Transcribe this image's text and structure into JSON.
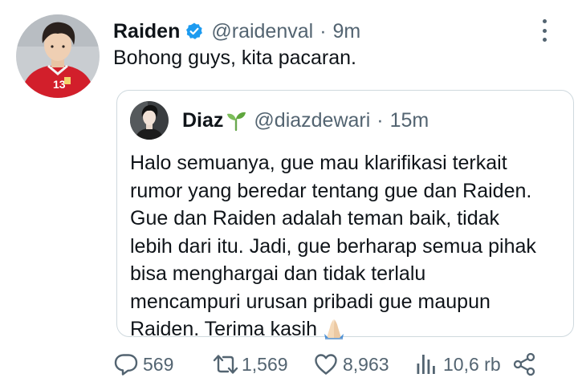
{
  "tweet": {
    "author_name": "Raiden",
    "author_handle": "@raidenval",
    "separator": "·",
    "time": "9m",
    "text": "Bohong guys, kita pacaran.",
    "avatar_icon": "user-avatar-photo",
    "verified_icon": "verified-badge-icon",
    "more_icon": "more-options-icon"
  },
  "quote": {
    "author_name": "Diaz",
    "name_emoji_icon": "seedling-emoji-icon",
    "author_handle": "@diazdewari",
    "separator": "·",
    "time": "15m",
    "lines": [
      "Halo semuanya, gue mau klarifikasi terkait",
      "rumor yang beredar tentang gue dan Raiden.",
      "Gue dan Raiden adalah teman baik, tidak",
      "lebih dari itu. Jadi, gue berharap semua pihak",
      "bisa menghargai dan tidak terlalu",
      "mencampuri urusan pribadi gue maupun",
      "Raiden. Terima kasih"
    ],
    "end_emoji_icon": "folded-hands-emoji-icon"
  },
  "actions": {
    "reply_count": "569",
    "retweet_count": "1,569",
    "like_count": "8,963",
    "views_count": "10,6 rb"
  },
  "colors": {
    "text": "#0f1419",
    "secondary": "#536471",
    "verified": "#1d9bf0",
    "border": "#cfd9de"
  }
}
